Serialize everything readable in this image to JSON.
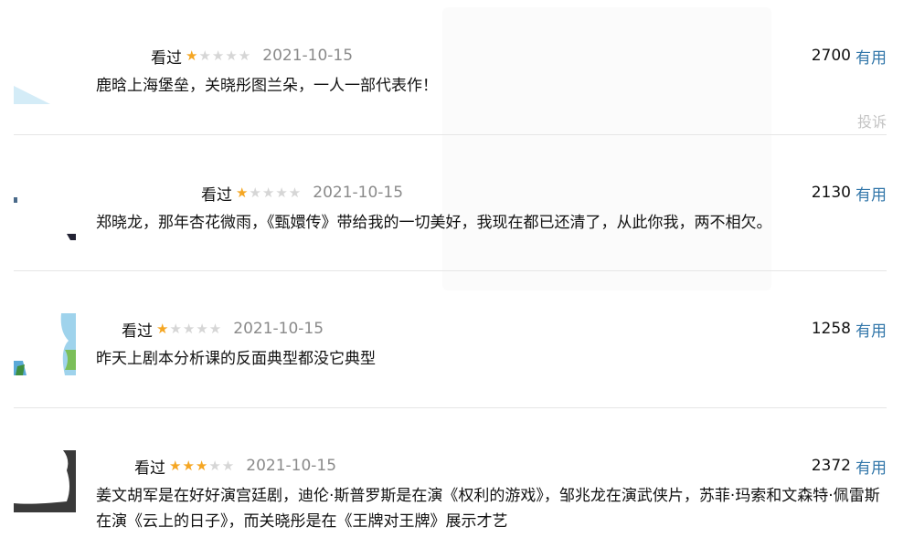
{
  "reviews": [
    {
      "status": "看过",
      "rating": 1,
      "date": "2021-10-15",
      "votes": "2700",
      "useful_label": "有用",
      "content": "鹿晗上海堡垒，关晓彤图兰朵，一人一部代表作！",
      "report_label": "投诉"
    },
    {
      "status": "看过",
      "rating": 1,
      "date": "2021-10-15",
      "votes": "2130",
      "useful_label": "有用",
      "content": "郑晓龙，那年杏花微雨，《甄嬛传》带给我的一切美好，我现在都已还清了，从此你我，两不相欠。"
    },
    {
      "status": "看过",
      "rating": 1,
      "date": "2021-10-15",
      "votes": "1258",
      "useful_label": "有用",
      "content": "昨天上剧本分析课的反面典型都没它典型"
    },
    {
      "status": "看过",
      "rating": 3,
      "date": "2021-10-15",
      "votes": "2372",
      "useful_label": "有用",
      "content": "姜文胡军是在好好演宫廷剧，迪伦·斯普罗斯是在演《权利的游戏》，邹兆龙在演武侠片，苏菲·玛索和文森特·佩雷斯在演《云上的日子》，而关晓彤是在《王牌对王牌》展示才艺"
    }
  ],
  "colors": {
    "star_on": "#f5a623",
    "star_off": "#d6d6d6",
    "link": "#3377aa",
    "date": "#8a8a8a",
    "report": "#c4c4c4"
  }
}
